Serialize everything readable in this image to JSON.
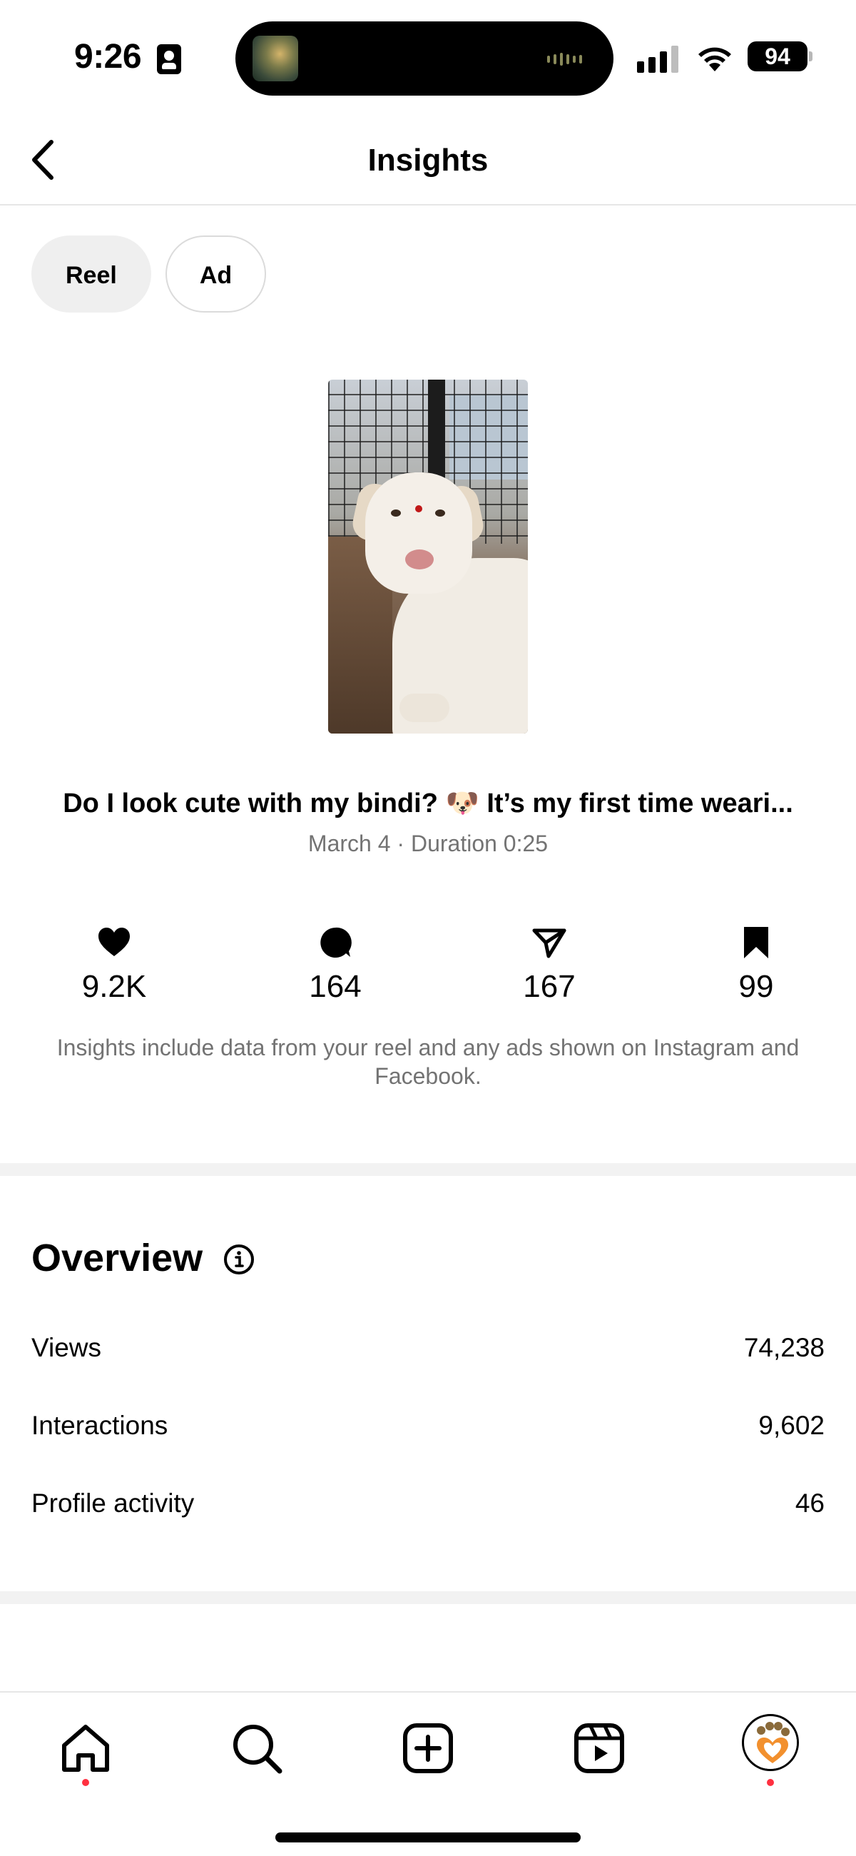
{
  "status_bar": {
    "time": "9:26",
    "battery": "94"
  },
  "header": {
    "title": "Insights"
  },
  "tabs": [
    {
      "label": "Reel",
      "active": true
    },
    {
      "label": "Ad",
      "active": false
    }
  ],
  "post": {
    "caption": "Do I look cute with my bindi? 🐶 It’s my first time weari...",
    "meta": "March 4 · Duration 0:25"
  },
  "stats": {
    "likes": "9.2K",
    "comments": "164",
    "shares": "167",
    "saves": "99"
  },
  "disclaimer": "Insights include data from your reel and any ads shown on Instagram and Facebook.",
  "overview": {
    "title": "Overview",
    "rows": [
      {
        "label": "Views",
        "value": "74,238"
      },
      {
        "label": "Interactions",
        "value": "9,602"
      },
      {
        "label": "Profile activity",
        "value": "46"
      }
    ]
  },
  "nav": {
    "items": [
      "home-icon",
      "search-icon",
      "create-icon",
      "reels-icon",
      "profile-avatar"
    ]
  }
}
